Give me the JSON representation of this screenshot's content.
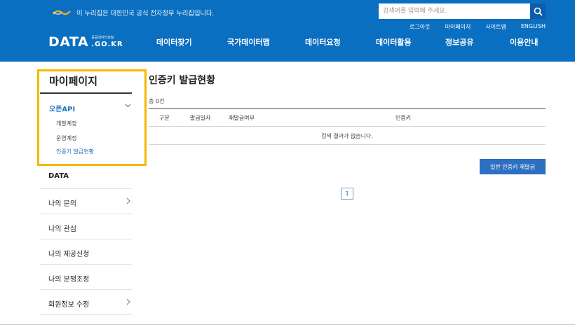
{
  "header": {
    "gov_banner_text": "이 누리집은 대한민국 공식 전자정부 누리집입니다.",
    "search": {
      "placeholder": "검색어를 입력해 주세요."
    },
    "util_nav": [
      "로그아웃",
      "마이페이지",
      "사이트맵",
      "ENGLISH"
    ],
    "logo": {
      "main": "DATA",
      "small": "공공데이터포털",
      "domain": ".GO.KR"
    },
    "gnb": [
      "데이터찾기",
      "국가데이터맵",
      "데이터요청",
      "데이터활용",
      "정보공유",
      "이용안내"
    ],
    "colors": {
      "header_bg": "#0b6fc1",
      "accent": "#1f6fc1",
      "highlight": "#f5b800"
    }
  },
  "sidebar": {
    "title": "마이페이지",
    "submenu": {
      "label": "오픈API",
      "children": [
        "개발계정",
        "운영계정",
        "인증키 발급현황"
      ],
      "active_index": 2
    },
    "items": [
      {
        "label": "DATA",
        "has_chevron": false
      },
      {
        "label": "나의 문의",
        "has_chevron": true
      },
      {
        "label": "나의 관심",
        "has_chevron": false
      },
      {
        "label": "나의 제공신청",
        "has_chevron": false
      },
      {
        "label": "나의 분쟁조정",
        "has_chevron": false
      },
      {
        "label": "회원정보 수정",
        "has_chevron": true
      }
    ]
  },
  "main": {
    "title": "인증키 발급현황",
    "total": "총 0건",
    "table": {
      "columns": [
        "구분",
        "발급일자",
        "재발급여부",
        "인증키"
      ],
      "empty_message": "검색 결과가 없습니다."
    },
    "reissue_button": "일반 인증키 재발급",
    "pagination": {
      "current_page": "1"
    }
  }
}
